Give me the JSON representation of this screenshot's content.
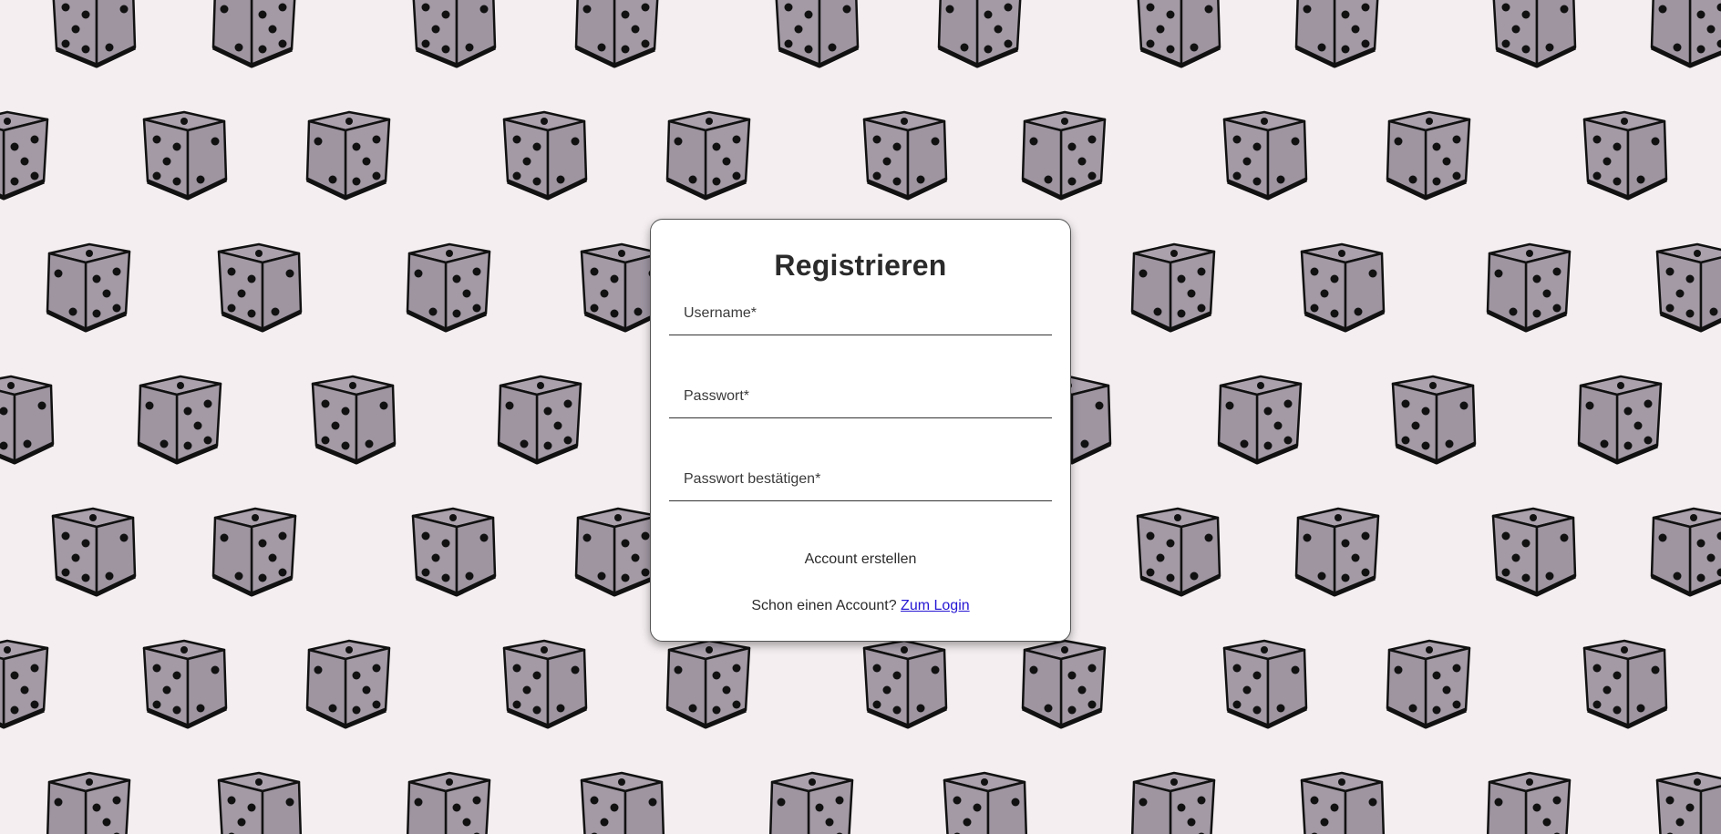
{
  "form": {
    "title": "Registrieren",
    "username_placeholder": "Username*",
    "password_placeholder": "Passwort*",
    "confirm_placeholder": "Passwort bestätigen*",
    "submit_label": "Account erstellen",
    "login_prompt": "Schon einen Account?",
    "login_link": "Zum Login"
  },
  "background": {
    "pattern": "dice-icon",
    "die_color": "#a49ba6",
    "page_color": "#f4eef0"
  }
}
